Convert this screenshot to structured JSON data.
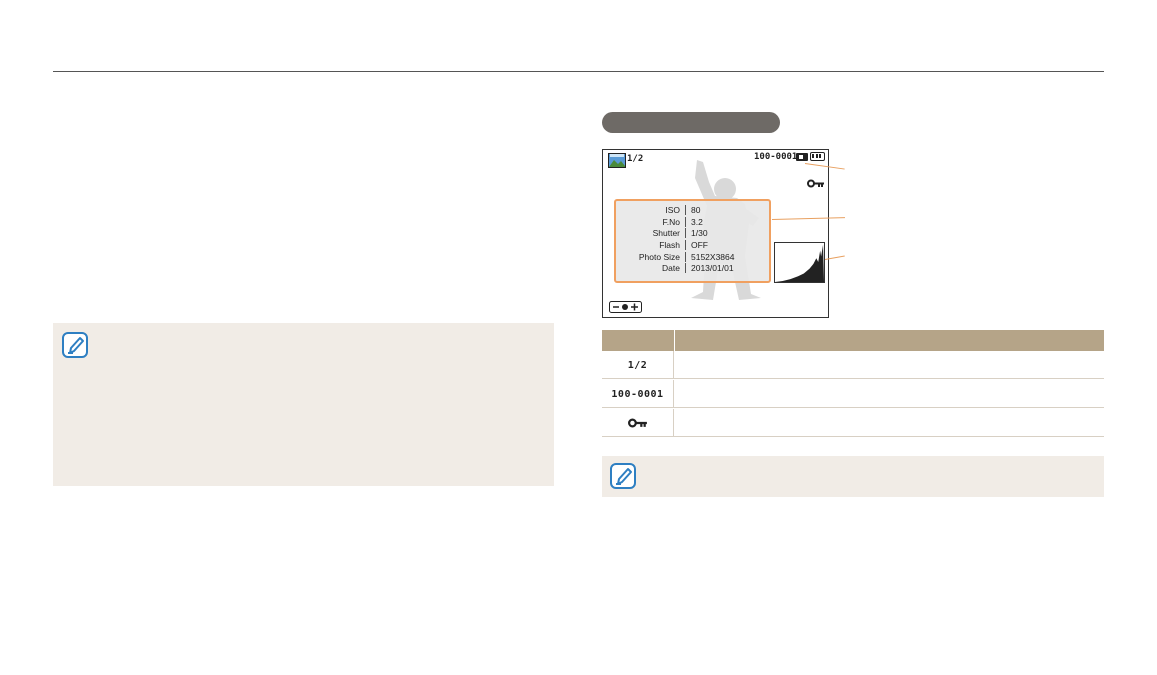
{
  "screen": {
    "counter": "1/2",
    "file_number": "100-0001",
    "info": [
      {
        "label": "ISO",
        "value": "80"
      },
      {
        "label": "F.No",
        "value": "3.2"
      },
      {
        "label": "Shutter",
        "value": "1/30"
      },
      {
        "label": "Flash",
        "value": "OFF"
      },
      {
        "label": "Photo Size",
        "value": "5152X3864"
      },
      {
        "label": "Date",
        "value": "2013/01/01"
      }
    ],
    "icons": [
      "image-thumbnail-icon",
      "memory-card-icon",
      "battery-icon",
      "protect-key-icon",
      "exposure-icon"
    ]
  },
  "table": {
    "rows": [
      {
        "icon_text": "1/2"
      },
      {
        "icon_text": "100-0001"
      },
      {
        "icon": "protect-key-icon"
      }
    ]
  },
  "colors": {
    "accent": "#e8a060",
    "table_header": "#b5a488",
    "note_bg": "#f1ece6",
    "pill": "#6e6a66",
    "note_icon": "#2e7fc2"
  }
}
